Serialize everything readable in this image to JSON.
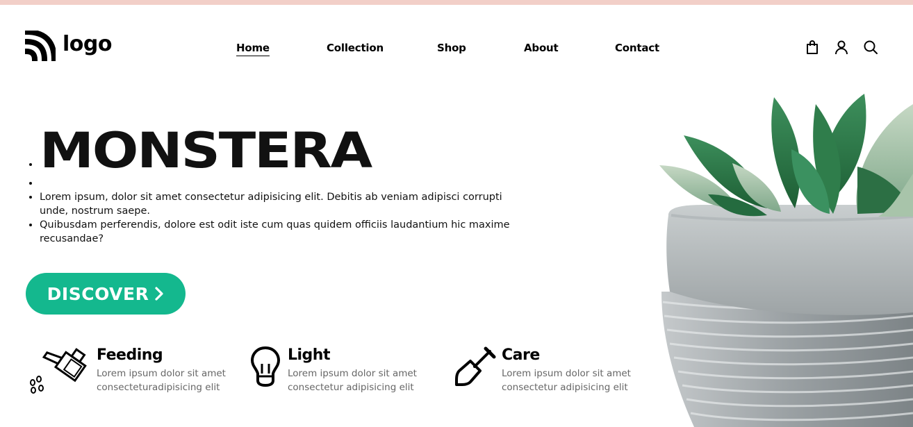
{
  "brand": {
    "logo_text": "logo"
  },
  "nav": {
    "items": [
      "Home",
      "Collection",
      "Shop",
      "About",
      "Contact"
    ]
  },
  "header_icons": [
    "shopping-bag-icon",
    "user-icon",
    "search-icon"
  ],
  "hero": {
    "title": "MONSTERA",
    "paragraphs": [
      "Lorem ipsum, dolor sit amet consectetur adipisicing elit. Debitis ab veniam adipisci corrupti unde, nostrum saepe.",
      "Quibusdam perferendis, dolore est odit iste cum quas quidem officiis laudantium hic maxime recusandae?"
    ],
    "cta_label": "DISCOVER"
  },
  "features": [
    {
      "title": "Feeding",
      "text": "Lorem ipsum dolor sit amet consecteturadipisicing elit",
      "icon": "watering-can-icon"
    },
    {
      "title": "Light",
      "text": "Lorem ipsum dolor sit amet consectetur adipisicing elit",
      "icon": "light-bulb-icon"
    },
    {
      "title": "Care",
      "text": "Lorem ipsum dolor sit amet consectetur adipisicing elit",
      "icon": "shovel-icon"
    }
  ],
  "colors": {
    "accent": "#14b88e",
    "topbar": "#f2cfc8",
    "muted_text": "#666666"
  }
}
